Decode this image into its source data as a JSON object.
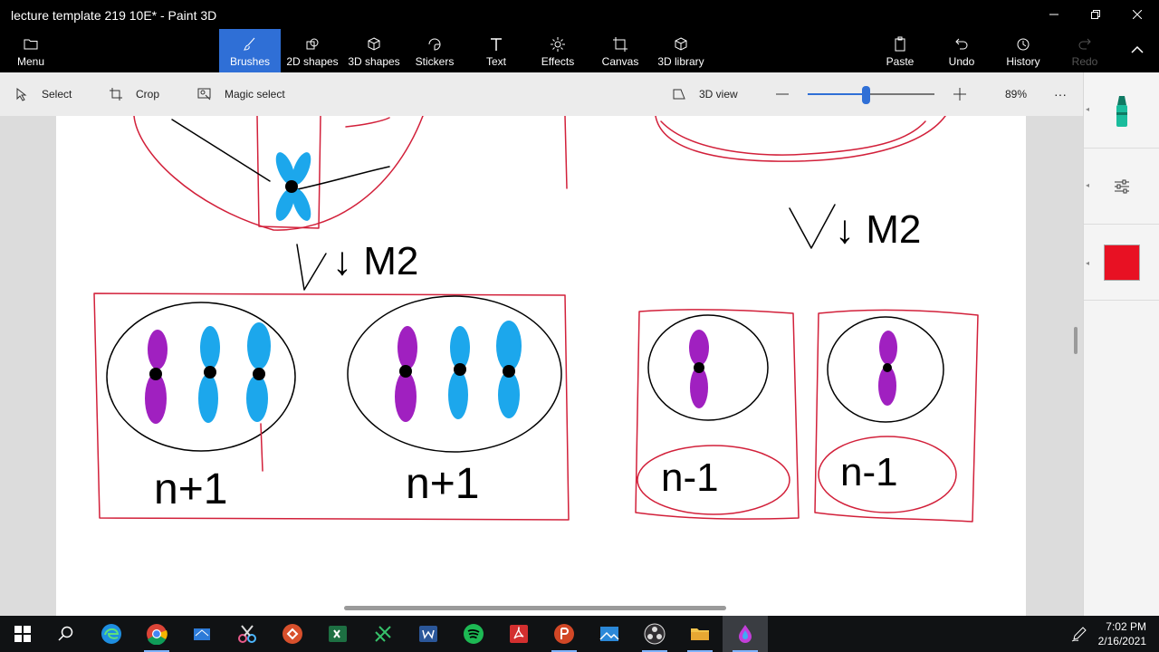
{
  "window": {
    "title": "lecture template 219 10E* - Paint 3D"
  },
  "ribbon": {
    "menu": "Menu",
    "brushes": "Brushes",
    "shapes2d": "2D shapes",
    "shapes3d": "3D shapes",
    "stickers": "Stickers",
    "text": "Text",
    "effects": "Effects",
    "canvas": "Canvas",
    "library3d": "3D library",
    "paste": "Paste",
    "undo": "Undo",
    "history": "History",
    "redo": "Redo"
  },
  "toolbar": {
    "select": "Select",
    "crop": "Crop",
    "magic_select": "Magic select",
    "view3d": "3D view",
    "zoom_level": 0.46,
    "zoom_percent": "89%",
    "more": "···"
  },
  "drawing": {
    "label_m2_a": "↓ M2",
    "label_m2_b": "↓ M2",
    "label_n_plus_1_a": "n+1",
    "label_n_plus_1_b": "n+1",
    "label_n_minus_1_a": "n-1",
    "label_n_minus_1_b": "n-1"
  },
  "side_panel": {
    "selected_color": "#e81123",
    "marker_color": "#1abc9c"
  },
  "taskbar": {
    "time": "7:02 PM",
    "date": "2/16/2021"
  },
  "colors": {
    "accent": "#2f6fd6",
    "red_ink": "#d2203a",
    "blue_chromosome": "#1ca7ec",
    "purple_chromosome": "#a020c0"
  }
}
